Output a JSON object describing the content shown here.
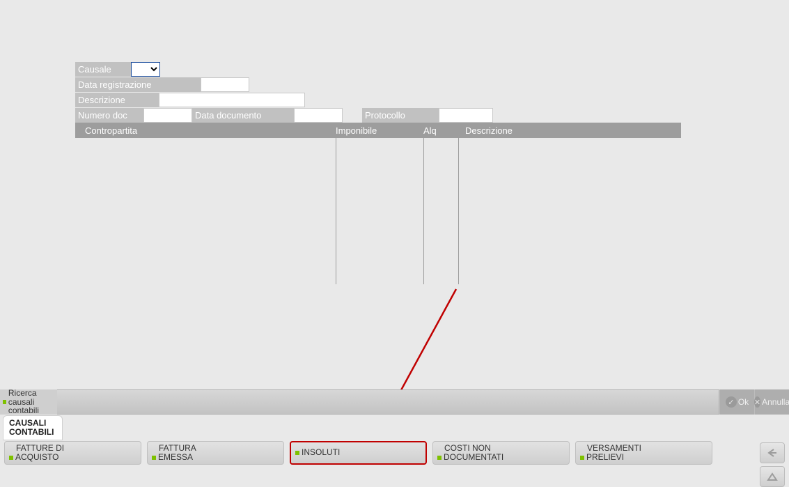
{
  "form": {
    "causale_label": "Causale",
    "causale_value": "",
    "data_reg_label": "Data registrazione",
    "data_reg_value": "",
    "descrizione_label": "Descrizione",
    "descrizione_value": "",
    "numero_doc_label": "Numero doc",
    "numero_doc_value": "",
    "data_doc_label": "Data documento",
    "data_doc_value": "",
    "protocollo_label": "Protocollo",
    "protocollo_value": ""
  },
  "grid_headers": {
    "contropartita": "Contropartita",
    "imponibile": "Imponibile",
    "alq": "Alq",
    "descrizione": "Descrizione"
  },
  "search": {
    "label_line1": "Ricerca causali",
    "label_line2": "contabili",
    "value": "",
    "ok_label": "Ok",
    "annulla_label": "Annulla"
  },
  "tab": {
    "label_line1": "CAUSALI",
    "label_line2": "CONTABILI"
  },
  "buttons": [
    {
      "line1": "FATTURE DI",
      "line2": "ACQUISTO",
      "highlight": false
    },
    {
      "line1": "FATTURA",
      "line2": "EMESSA",
      "highlight": false
    },
    {
      "line1": "",
      "line2": "INSOLUTI",
      "highlight": true
    },
    {
      "line1": "COSTI NON",
      "line2": "DOCUMENTATI",
      "highlight": false
    },
    {
      "line1": "VERSAMENTI",
      "line2": "PRELIEVI",
      "highlight": false
    }
  ]
}
